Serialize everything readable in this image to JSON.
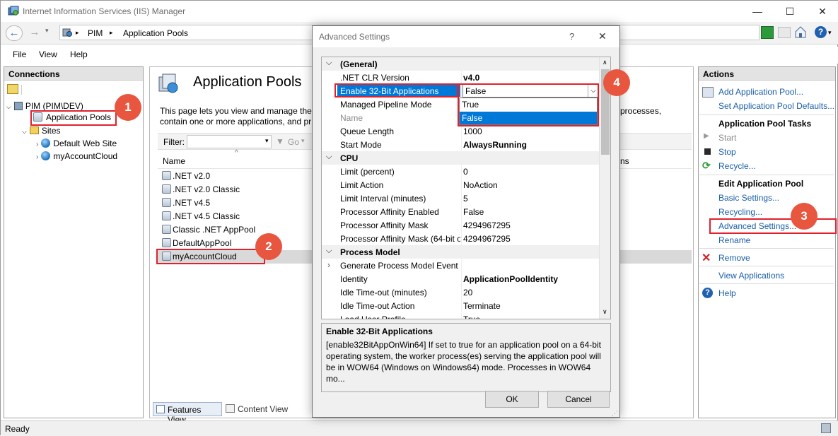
{
  "window": {
    "title": "Internet Information Services (IIS) Manager",
    "minimize": "—",
    "maximize": "☐",
    "close": "✕"
  },
  "nav": {
    "back": "←",
    "forward": "→",
    "crumbs": [
      "PIM",
      "Application Pools"
    ],
    "crumb_sep": "▸"
  },
  "menu": [
    "File",
    "View",
    "Help"
  ],
  "connections": {
    "header": "Connections",
    "tree": {
      "server": "PIM (PIM\\DEV)",
      "app_pools": "Application Pools",
      "sites": "Sites",
      "site_items": [
        "Default Web Site",
        "myAccountCloud"
      ]
    }
  },
  "center": {
    "title": "Application Pools",
    "description": "This page lets you view and manage the l                                                                                                                                  processes, contain one or more applications, and pr",
    "desc_line1": "This page lets you view and manage the l",
    "desc_line1_tail": "processes,",
    "desc_line2": "contain one or more applications, and pr",
    "filter_label": "Filter:",
    "go_label": "Go",
    "col_name": "Name",
    "col_right": "ns",
    "pools": [
      ".NET v2.0",
      ".NET v2.0 Classic",
      ".NET v4.5",
      ".NET v4.5 Classic",
      "Classic .NET AppPool",
      "DefaultAppPool",
      "myAccountCloud"
    ],
    "features_view": "Features View",
    "content_view": "Content View"
  },
  "actions": {
    "header": "Actions",
    "add_pool": "Add Application Pool...",
    "set_defaults": "Set Application Pool Defaults...",
    "tasks_header": "Application Pool Tasks",
    "start": "Start",
    "stop": "Stop",
    "recycle": "Recycle...",
    "edit_header": "Edit Application Pool",
    "basic": "Basic Settings...",
    "recycling": "Recycling...",
    "advanced": "Advanced Settings...",
    "rename": "Rename",
    "remove": "Remove",
    "view_apps": "View Applications",
    "help": "Help"
  },
  "dialog": {
    "title": "Advanced Settings",
    "help": "?",
    "close": "✕",
    "rows": [
      {
        "type": "cat",
        "k": "(General)"
      },
      {
        "type": "row",
        "k": ".NET CLR Version",
        "v": "v4.0",
        "bold": true
      },
      {
        "type": "row",
        "k": "Enable 32-Bit Applications",
        "v": "False",
        "selected": true
      },
      {
        "type": "row",
        "k": "Managed Pipeline Mode",
        "v": "True"
      },
      {
        "type": "row",
        "k": "Name",
        "v": "",
        "dim": true
      },
      {
        "type": "row",
        "k": "Queue Length",
        "v": "1000"
      },
      {
        "type": "row",
        "k": "Start Mode",
        "v": "AlwaysRunning",
        "bold": true
      },
      {
        "type": "cat",
        "k": "CPU"
      },
      {
        "type": "row",
        "k": "Limit (percent)",
        "v": "0"
      },
      {
        "type": "row",
        "k": "Limit Action",
        "v": "NoAction"
      },
      {
        "type": "row",
        "k": "Limit Interval (minutes)",
        "v": "5"
      },
      {
        "type": "row",
        "k": "Processor Affinity Enabled",
        "v": "False"
      },
      {
        "type": "row",
        "k": "Processor Affinity Mask",
        "v": "4294967295"
      },
      {
        "type": "row",
        "k": "Processor Affinity Mask (64-bit o",
        "v": "4294967295"
      },
      {
        "type": "cat",
        "k": "Process Model"
      },
      {
        "type": "row",
        "k": "Generate Process Model Event L",
        "v": "",
        "expand": true
      },
      {
        "type": "row",
        "k": "Identity",
        "v": "ApplicationPoolIdentity",
        "bold": true
      },
      {
        "type": "row",
        "k": "Idle Time-out (minutes)",
        "v": "20"
      },
      {
        "type": "row",
        "k": "Idle Time-out Action",
        "v": "Terminate"
      },
      {
        "type": "row",
        "k": "Load User Profile",
        "v": "True"
      }
    ],
    "dropdown_options": [
      "True",
      "False"
    ],
    "desc_title": "Enable 32-Bit Applications",
    "desc_body": "[enable32BitAppOnWin64] If set to true for an application pool on a 64-bit operating system, the worker process(es) serving the application pool will be in WOW64 (Windows on Windows64) mode. Processes in WOW64 mo...",
    "ok": "OK",
    "cancel": "Cancel"
  },
  "callouts": [
    "1",
    "2",
    "3",
    "4"
  ],
  "status": {
    "text": "Ready"
  },
  "colors": {
    "annotation_red": "#e0212d",
    "callout": "#e8563f",
    "selection": "#0078d7",
    "link": "#1a5ea8"
  }
}
